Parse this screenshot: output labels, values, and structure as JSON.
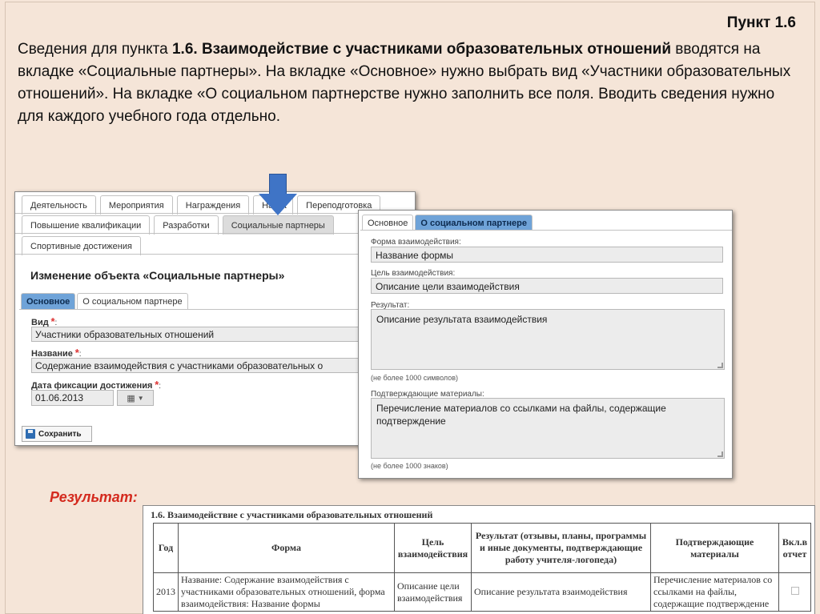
{
  "slide": {
    "point_title": "Пункт 1.6",
    "intro": {
      "p1": "Сведения для пункта ",
      "bold": "1.6. Взаимодействие с участниками образовательных отношений",
      "p2": " вводятся на вкладке «Социальные партнеры». На вкладке «Основное» нужно выбрать вид «Участники образовательных отношений». На вкладке «О социальном партнерстве нужно заполнить все поля. Вводить сведения нужно для каждого учебного года отдельно."
    },
    "result_heading": "Результат:"
  },
  "left_panel": {
    "tabs_row1": [
      "Деятельность",
      "Мероприятия",
      "Награждения",
      "Наука",
      "Переподготовка"
    ],
    "tabs_row2": [
      "Повышение квалификации",
      "Разработки",
      "Социальные партнеры"
    ],
    "tabs_row3": [
      "Спортивные достижения"
    ],
    "object_title": "Изменение объекта «Социальные партнеры»",
    "subtabs": [
      "Основное",
      "О социальном партнере"
    ],
    "fields": {
      "vid_label": "Вид",
      "vid_value": "Участники образовательных отношений",
      "name_label": "Название",
      "name_value": "Содержание взаимодействия с участниками образовательных о",
      "date_label": "Дата фиксации достижения",
      "date_value": "01.06.2013"
    },
    "required_mark": "*",
    "colon": ":",
    "save_label": "Сохранить"
  },
  "right_panel": {
    "tabs": [
      "Основное",
      "О социальном партнере"
    ],
    "form_label": "Форма взаимодействия:",
    "form_value": "Название формы",
    "goal_label": "Цель взаимодействия:",
    "goal_value": "Описание цели взаимодействия",
    "result_label": "Результат:",
    "result_value": "Описание результата взаимодействия",
    "result_hint": "(не более 1000 символов)",
    "materials_label": "Подтверждающие материалы:",
    "materials_value": "Перечисление материалов со ссылками на файлы, содержащие подтверждение",
    "materials_hint": "(не более 1000 знаков)"
  },
  "report": {
    "title": "1.6. Взаимодействие с участниками образовательных отношений",
    "headers": [
      "Год",
      "Форма",
      "Цель взаимодействия",
      "Результат (отзывы, планы, программы и иные документы, подтверждающие работу учителя-логопеда)",
      "Подтверждающие материалы",
      "Вкл.в отчет"
    ],
    "row": {
      "year": "2013",
      "form": "Название: Содержание взаимодействия с участниками образовательных отношений, форма взаимодействия: Название формы",
      "goal": "Описание цели взаимодействия",
      "result": "Описание результата взаимодействия",
      "materials": "Перечисление материалов со ссылками на файлы, содержащие подтверждение"
    }
  },
  "colors": {
    "background": "#f5e5d8",
    "accent_blue": "#6fa3d8",
    "arrow": "#3f74c6",
    "result_red": "#d42a1e"
  },
  "icons": [
    "down-arrow-icon",
    "calendar-icon",
    "chevron-down-icon",
    "save-icon",
    "checkbox-icon"
  ]
}
